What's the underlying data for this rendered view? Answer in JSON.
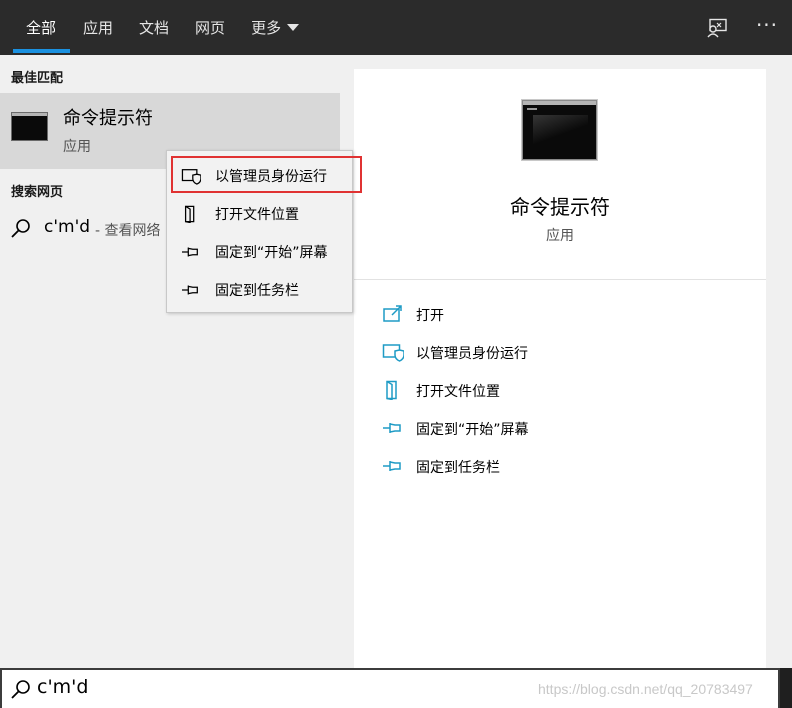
{
  "tabs": [
    {
      "label": "全部",
      "active": true
    },
    {
      "label": "应用"
    },
    {
      "label": "文档"
    },
    {
      "label": "网页"
    },
    {
      "label": "更多"
    }
  ],
  "top_icons": {
    "feedback": "feedback-icon",
    "more": "···"
  },
  "left": {
    "best_match_header": "最佳匹配",
    "best_match": {
      "title": "命令提示符",
      "subtitle": "应用"
    },
    "web_header": "搜索网页",
    "web_query": "c'm'd",
    "web_suffix": "- 查看网络"
  },
  "context_menu": {
    "items": [
      {
        "label": "以管理员身份运行",
        "icon": "shield-window-icon",
        "highlighted": true
      },
      {
        "label": "打开文件位置",
        "icon": "folder-location-icon"
      },
      {
        "label": "固定到“开始”屏幕",
        "icon": "pin-icon"
      },
      {
        "label": "固定到任务栏",
        "icon": "pin-icon"
      }
    ],
    "highlight_color": "#e03232"
  },
  "detail": {
    "title": "命令提示符",
    "subtitle": "应用",
    "actions": [
      {
        "label": "打开",
        "icon": "open-icon"
      },
      {
        "label": "以管理员身份运行",
        "icon": "shield-window-icon"
      },
      {
        "label": "打开文件位置",
        "icon": "folder-location-icon"
      },
      {
        "label": "固定到“开始”屏幕",
        "icon": "pin-icon"
      },
      {
        "label": "固定到任务栏",
        "icon": "pin-icon"
      }
    ]
  },
  "search": {
    "value": "c'm'd"
  },
  "watermark": "https://blog.csdn.net/qq_20783497",
  "colors": {
    "accent": "#1b91e0",
    "icon_teal": "#1f9bc5",
    "topbar": "#2b2b2b"
  }
}
